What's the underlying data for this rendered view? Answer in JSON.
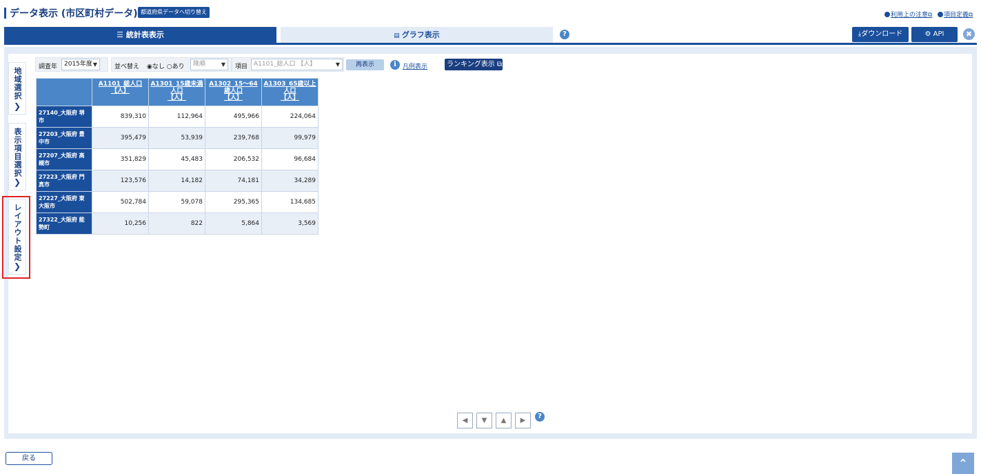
{
  "header": {
    "title": "データ表示 (市区町村データ)",
    "switch_label": "都道府県データへ切り替え",
    "links": [
      "利用上の注意",
      "項目定義"
    ]
  },
  "tabs": {
    "active": "統計表表示",
    "inactive": "グラフ表示"
  },
  "tools": {
    "download": "ダウンロード",
    "api": "API"
  },
  "side_tabs": [
    "地域選択",
    "表示項目選択",
    "レイアウト設定"
  ],
  "toolbar": {
    "year_label": "調査年",
    "year_value": "2015年度",
    "sort_label": "並べ替え",
    "sort_options": "◉なし ○あり",
    "order_value": "降順",
    "item_label": "項目",
    "item_value": "A1101_総人口 【人】",
    "redisplay": "再表示",
    "legend": "凡例表示",
    "ranking": "ランキング表示"
  },
  "table": {
    "headers": [
      [
        "A1101_総人口",
        "【人】"
      ],
      [
        "A1301_15歳未満",
        "人口",
        "【人】"
      ],
      [
        "A1302_15～64",
        "歳人口",
        "【人】"
      ],
      [
        "A1303_65歳以上",
        "人口",
        "【人】"
      ]
    ],
    "rows": [
      {
        "label": "27140_大阪府 堺市",
        "values": [
          "839,310",
          "112,964",
          "495,966",
          "224,064"
        ]
      },
      {
        "label": "27203_大阪府 豊中市",
        "values": [
          "395,479",
          "53,939",
          "239,768",
          "99,979"
        ]
      },
      {
        "label": "27207_大阪府 高槻市",
        "values": [
          "351,829",
          "45,483",
          "206,532",
          "96,684"
        ]
      },
      {
        "label": "27223_大阪府 門真市",
        "values": [
          "123,576",
          "14,182",
          "74,181",
          "34,289"
        ]
      },
      {
        "label": "27227_大阪府 東大阪市",
        "values": [
          "502,784",
          "59,078",
          "295,365",
          "134,685"
        ]
      },
      {
        "label": "27322_大阪府 能勢町",
        "values": [
          "10,256",
          "822",
          "5,864",
          "3,569"
        ]
      }
    ]
  },
  "footer": {
    "back": "戻る"
  },
  "colors": {
    "primary": "#1a4f9c",
    "header_cell": "#4a86c8",
    "panel_bg": "#e3ebf6",
    "highlight": "#e02020"
  }
}
